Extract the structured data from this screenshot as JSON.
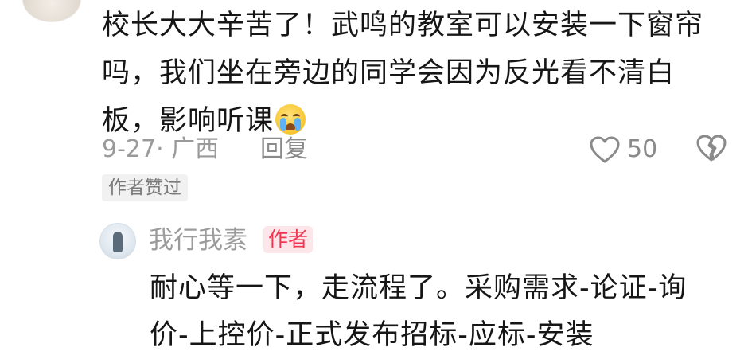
{
  "comment": {
    "lines": [
      "校长大大辛苦了！武鸣的教室可以安装一下窗帘",
      "吗，我们坐在旁边的同学会因为反光看不清白",
      "板，影响听课"
    ],
    "emoji": "crying-face-emoji",
    "date_location": "9-27· 广西",
    "reply_label": "回复",
    "like_count": "50",
    "author_liked_label": "作者赞过"
  },
  "reply": {
    "username": "我行我素",
    "badge": "作者",
    "lines": [
      "耐心等一下，走流程了。采购需求-论证-询",
      "价-上控价-正式发布招标-应标-安装"
    ]
  },
  "icons": {
    "like": "heart-outline-icon",
    "dislike": "broken-heart-icon"
  },
  "colors": {
    "badge_text": "#f0344f",
    "badge_bg": "#fde6ea",
    "muted_text": "#9a9a9a",
    "body_text": "#161616"
  }
}
